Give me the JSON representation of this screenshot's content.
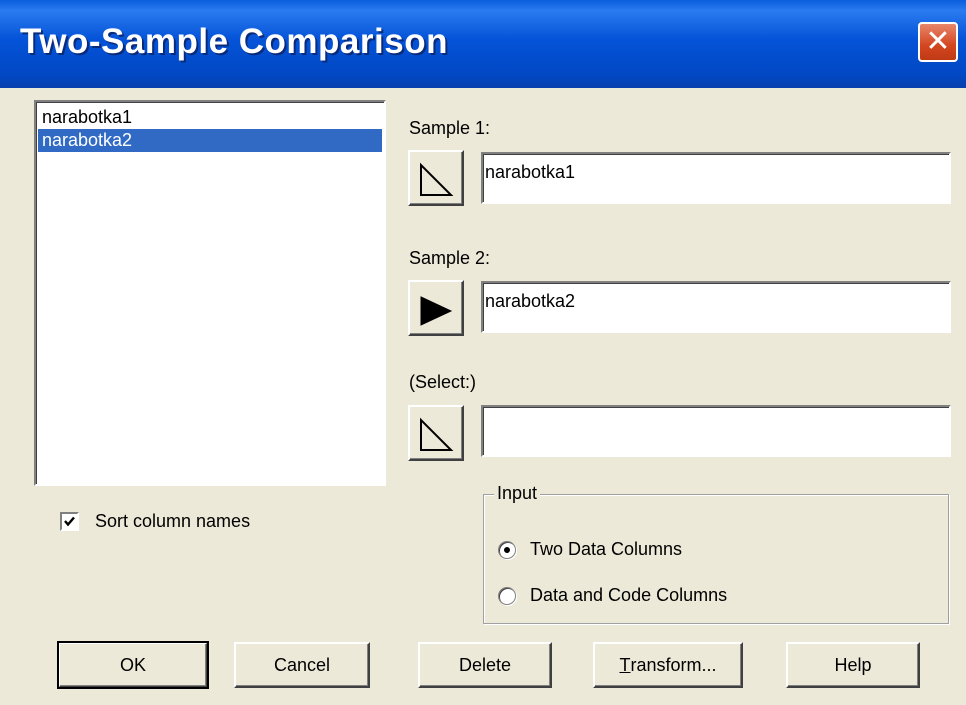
{
  "window": {
    "title": "Two-Sample Comparison",
    "close_glyph": "✕"
  },
  "columns_list": {
    "items": [
      "narabotka1",
      "narabotka2"
    ],
    "selected_index": 1
  },
  "sample1": {
    "label": "Sample 1:",
    "value": "narabotka1",
    "button_icon": "arrow-outline-icon"
  },
  "sample2": {
    "label": "Sample 2:",
    "value": "narabotka2",
    "button_icon": "arrow-filled-icon"
  },
  "select": {
    "label": "(Select:)",
    "value": "",
    "button_icon": "arrow-outline-icon"
  },
  "sort_columns": {
    "label": "Sort column names",
    "checked": true
  },
  "input_group": {
    "title": "Input",
    "options": [
      {
        "label": "Two Data Columns",
        "selected": true
      },
      {
        "label": "Data and Code Columns",
        "selected": false
      }
    ]
  },
  "buttons": {
    "ok": "OK",
    "cancel": "Cancel",
    "delete": "Delete",
    "transform_mnemonic": "T",
    "transform_rest": "ransform...",
    "help": "Help"
  },
  "colors": {
    "titlebar": "#0453d8",
    "selection": "#316ac5",
    "face": "#ece9d8",
    "close": "#d3461f"
  }
}
